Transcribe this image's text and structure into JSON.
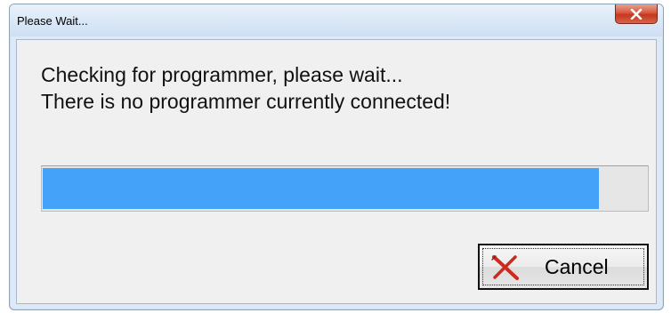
{
  "window": {
    "title": "Please Wait..."
  },
  "message": {
    "line1": "Checking for programmer, please wait...",
    "line2": "There is no programmer currently connected!"
  },
  "progress": {
    "value_percent": 92
  },
  "buttons": {
    "cancel_label": "Cancel"
  },
  "icons": {
    "close": "close-icon",
    "cancel": "red-x-icon"
  },
  "colors": {
    "progress_fill": "#44a2f8",
    "close_button": "#c4361f",
    "cancel_icon": "#d0281c"
  }
}
